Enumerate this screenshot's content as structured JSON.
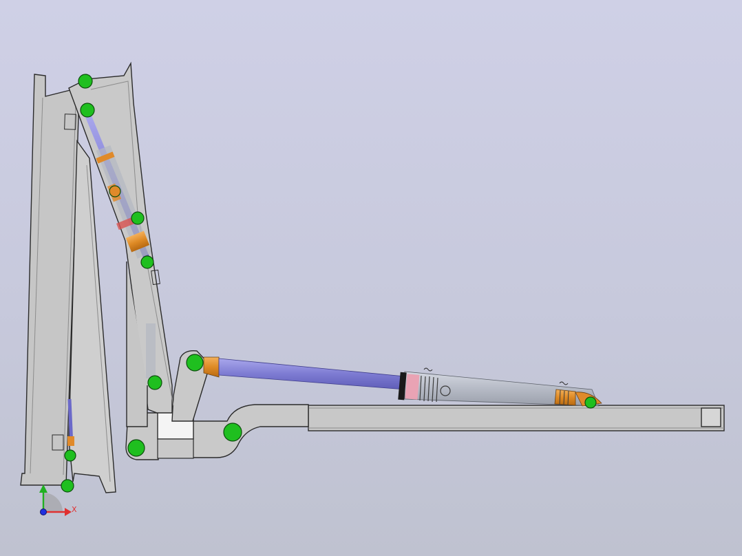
{
  "viewport": {
    "background_top": "#cfd0e6",
    "background_bottom": "#bfc2d0"
  },
  "colors": {
    "frame": "#c9c9c9",
    "frame_dark": "#a9a9a9",
    "outline": "#2a2a2a",
    "pin": "#1fbf1f",
    "rod": "#8a88d8",
    "barrel": "#b7bcc6",
    "fitting": "#e08a2a",
    "seal_red": "#d9534f",
    "seal_pink": "#e9a3b4"
  },
  "triad": {
    "x_label": "X",
    "x_color": "#e03030",
    "y_color": "#20b020",
    "z_color": "#2030e0",
    "icon": "coordinate-triad-icon"
  }
}
